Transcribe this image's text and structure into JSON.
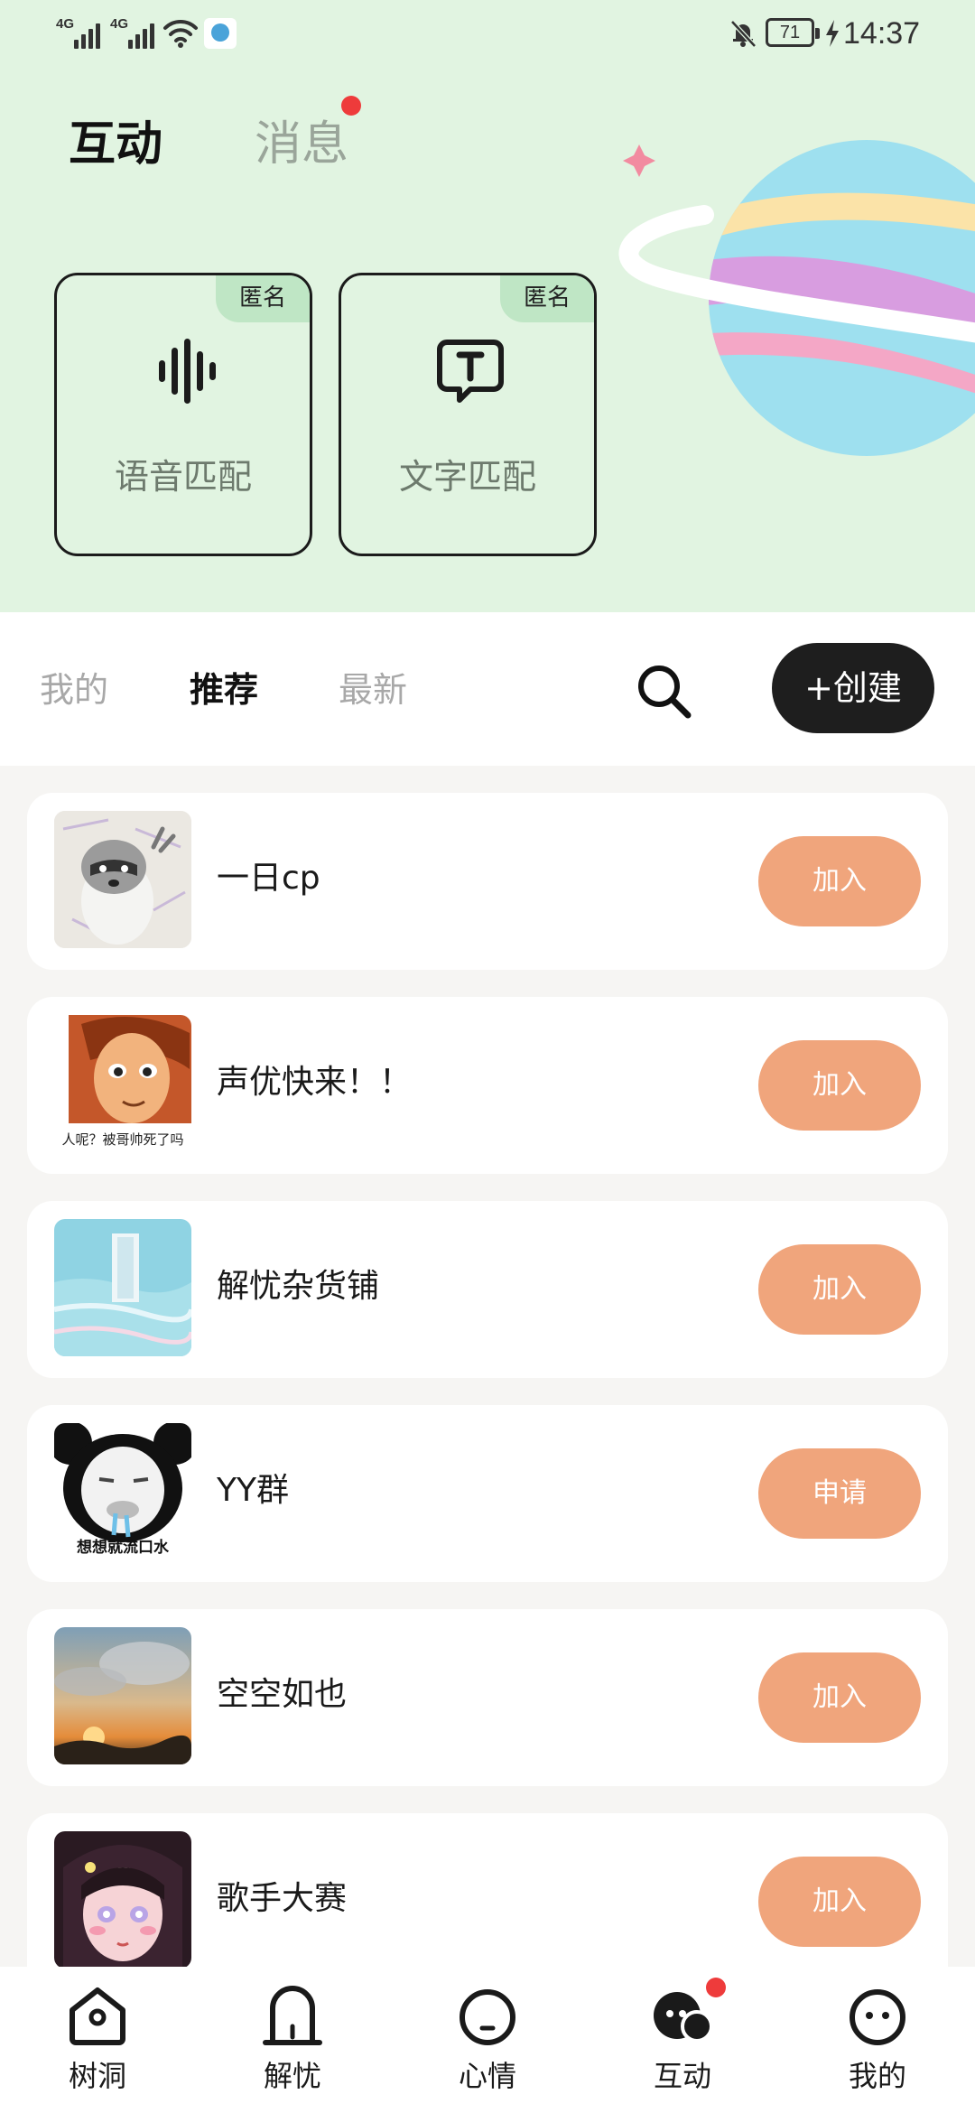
{
  "status_bar": {
    "network_1": "4G",
    "network_2": "4G",
    "battery": "71",
    "time": "14:37"
  },
  "top_tabs": [
    {
      "label": "互动",
      "active": true
    },
    {
      "label": "消息",
      "active": false,
      "has_dot": true
    }
  ],
  "match_cards": [
    {
      "badge": "匿名",
      "label": "语音匹配",
      "icon": "voice-wave-icon"
    },
    {
      "badge": "匿名",
      "label": "文字匹配",
      "icon": "text-chat-icon"
    }
  ],
  "filter_tabs": [
    {
      "label": "我的",
      "active": false
    },
    {
      "label": "推荐",
      "active": true
    },
    {
      "label": "最新",
      "active": false
    }
  ],
  "create_label": "+创建",
  "groups": [
    {
      "name": "一日cp",
      "action": "加入"
    },
    {
      "name": "声优快来！！",
      "action": "加入",
      "avatar_caption": "人呢？被哥帅死了吗"
    },
    {
      "name": "解忧杂货铺",
      "action": "加入"
    },
    {
      "name": "YY群",
      "action": "申请",
      "avatar_caption": "想想就流口水"
    },
    {
      "name": "空空如也",
      "action": "加入"
    },
    {
      "name": "歌手大赛",
      "action": "加入"
    }
  ],
  "bottom_nav": [
    {
      "label": "树洞",
      "icon": "house-location-icon"
    },
    {
      "label": "解忧",
      "icon": "door-icon"
    },
    {
      "label": "心情",
      "icon": "mood-face-icon"
    },
    {
      "label": "互动",
      "icon": "chat-bubbles-icon",
      "active": true,
      "has_dot": true
    },
    {
      "label": "我的",
      "icon": "profile-face-icon"
    }
  ],
  "colors": {
    "hero_bg": "#e1f4e1",
    "join_button": "#f0a57c",
    "create_button": "#1e1e1e",
    "badge_bg": "#bfe6c5",
    "dot": "#ee3b3b"
  }
}
